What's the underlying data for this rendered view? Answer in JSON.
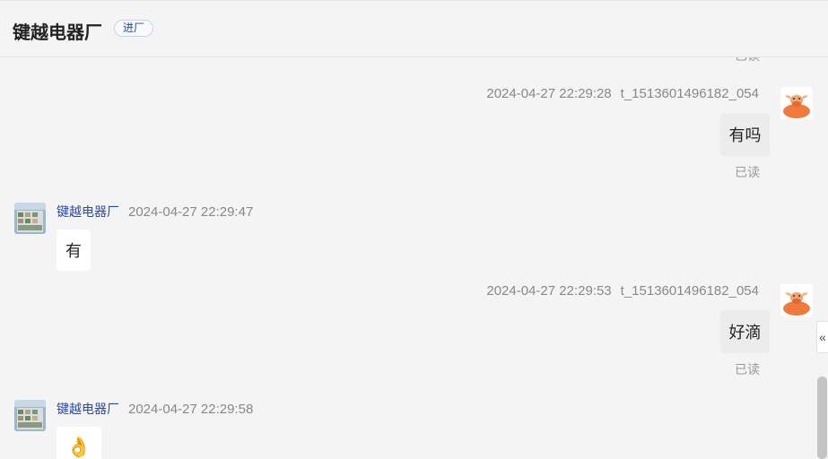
{
  "header": {
    "title": "键越电器厂",
    "badge": "进厂"
  },
  "messages": [
    {
      "read": "已读"
    },
    {
      "time": "2024-04-27 22:29:28",
      "user": "t_1513601496182_054",
      "text": "有吗",
      "read": "已读"
    },
    {
      "sender": "键越电器厂",
      "time": "2024-04-27 22:29:47",
      "text": "有"
    },
    {
      "time": "2024-04-27 22:29:53",
      "user": "t_1513601496182_054",
      "text": "好滴",
      "read": "已读"
    },
    {
      "sender": "键越电器厂",
      "time": "2024-04-27 22:29:58",
      "emoji": "👌"
    }
  ],
  "controls": {
    "collapse_icon": "«"
  },
  "colors": {
    "background": "#f4f4f4",
    "sender_name": "#2b4aa0",
    "avatar_bull": "#f07a3c"
  }
}
